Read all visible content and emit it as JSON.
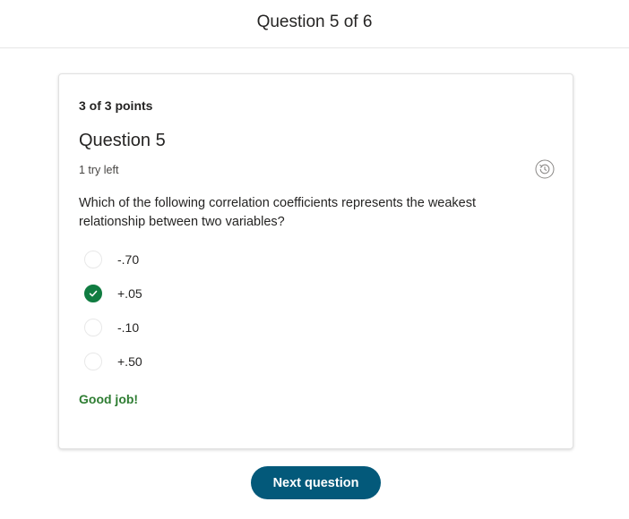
{
  "header": {
    "title": "Question 5 of 6"
  },
  "question": {
    "points": "3 of 3 points",
    "title": "Question 5",
    "tries": "1 try left",
    "prompt": "Which of the following correlation coefficients represents the weakest relationship between two variables?",
    "options": [
      {
        "label": "-.70",
        "selected": false
      },
      {
        "label": "+.05",
        "selected": true
      },
      {
        "label": "-.10",
        "selected": false
      },
      {
        "label": "+.50",
        "selected": false
      }
    ],
    "feedback": "Good job!"
  },
  "footer": {
    "next_label": "Next question"
  },
  "colors": {
    "correct_green": "#107c41",
    "feedback_green": "#2e7d32",
    "button_blue": "#03597a"
  },
  "icons": {
    "history": "history-icon",
    "check": "check-icon"
  }
}
